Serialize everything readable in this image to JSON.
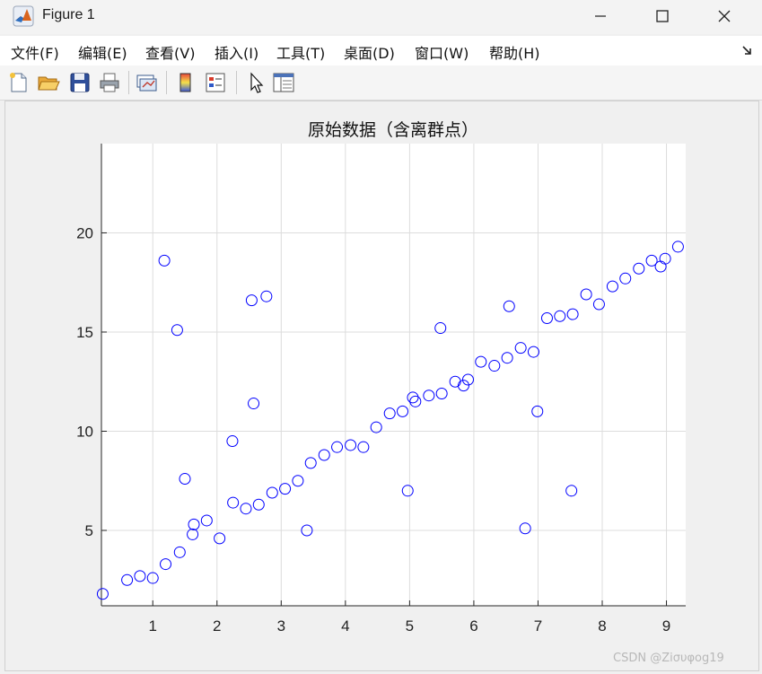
{
  "window": {
    "title": "Figure 1"
  },
  "menu": [
    {
      "label": "文件(F)",
      "name": "menu-file"
    },
    {
      "label": "编辑(E)",
      "name": "menu-edit"
    },
    {
      "label": "查看(V)",
      "name": "menu-view"
    },
    {
      "label": "插入(I)",
      "name": "menu-insert"
    },
    {
      "label": "工具(T)",
      "name": "menu-tools"
    },
    {
      "label": "桌面(D)",
      "name": "menu-desktop"
    },
    {
      "label": "窗口(W)",
      "name": "menu-window"
    },
    {
      "label": "帮助(H)",
      "name": "menu-help"
    }
  ],
  "toolbar": {
    "buttons": [
      {
        "name": "new-figure-button",
        "icon": "new-file-icon"
      },
      {
        "name": "open-file-button",
        "icon": "folder-open-icon"
      },
      {
        "name": "save-button",
        "icon": "floppy-disk-icon"
      },
      {
        "name": "print-button",
        "icon": "printer-icon"
      },
      {
        "name": "link-plot-button",
        "icon": "link-plot-icon"
      },
      {
        "name": "insert-colorbar-button",
        "icon": "colorbar-icon"
      },
      {
        "name": "insert-legend-button",
        "icon": "legend-icon"
      },
      {
        "name": "edit-plot-button",
        "icon": "cursor-arrow-icon"
      },
      {
        "name": "property-inspector-button",
        "icon": "property-panel-icon"
      }
    ]
  },
  "chart_data": {
    "type": "scatter",
    "title": "原始数据（含离群点）",
    "xlabel": "",
    "ylabel": "",
    "xlim": [
      0.2,
      9.3
    ],
    "ylim": [
      1.2,
      24.5
    ],
    "xticks": [
      1,
      2,
      3,
      4,
      5,
      6,
      7,
      8,
      9
    ],
    "yticks": [
      5,
      10,
      15,
      20
    ],
    "grid": true,
    "marker": "circle",
    "marker_color": "#0000ff",
    "points": [
      [
        0.22,
        1.8
      ],
      [
        0.6,
        2.5
      ],
      [
        0.8,
        2.7
      ],
      [
        1.0,
        2.6
      ],
      [
        1.2,
        3.3
      ],
      [
        1.42,
        3.9
      ],
      [
        1.62,
        4.8
      ],
      [
        1.64,
        5.3
      ],
      [
        1.84,
        5.5
      ],
      [
        2.04,
        4.6
      ],
      [
        2.25,
        6.4
      ],
      [
        2.45,
        6.1
      ],
      [
        2.65,
        6.3
      ],
      [
        2.86,
        6.9
      ],
      [
        3.06,
        7.1
      ],
      [
        3.26,
        7.5
      ],
      [
        3.46,
        8.4
      ],
      [
        3.67,
        8.8
      ],
      [
        3.87,
        9.2
      ],
      [
        4.08,
        9.3
      ],
      [
        4.28,
        9.2
      ],
      [
        4.48,
        10.2
      ],
      [
        4.69,
        10.9
      ],
      [
        4.89,
        11.0
      ],
      [
        5.09,
        11.5
      ],
      [
        5.05,
        11.7
      ],
      [
        5.3,
        11.8
      ],
      [
        5.5,
        11.9
      ],
      [
        5.71,
        12.5
      ],
      [
        5.84,
        12.3
      ],
      [
        5.91,
        12.6
      ],
      [
        6.11,
        13.5
      ],
      [
        6.32,
        13.3
      ],
      [
        6.52,
        13.7
      ],
      [
        6.73,
        14.2
      ],
      [
        6.93,
        14.0
      ],
      [
        7.14,
        15.7
      ],
      [
        7.34,
        15.8
      ],
      [
        7.54,
        15.9
      ],
      [
        7.75,
        16.9
      ],
      [
        7.95,
        16.4
      ],
      [
        8.16,
        17.3
      ],
      [
        8.36,
        17.7
      ],
      [
        8.57,
        18.2
      ],
      [
        8.77,
        18.6
      ],
      [
        8.91,
        18.3
      ],
      [
        8.98,
        18.7
      ],
      [
        9.18,
        19.3
      ],
      [
        1.18,
        18.6
      ],
      [
        1.38,
        15.1
      ],
      [
        2.54,
        16.6
      ],
      [
        2.77,
        16.8
      ],
      [
        1.5,
        7.6
      ],
      [
        2.24,
        9.5
      ],
      [
        2.57,
        11.4
      ],
      [
        3.4,
        5.0
      ],
      [
        4.97,
        7.0
      ],
      [
        5.48,
        15.2
      ],
      [
        6.55,
        16.3
      ],
      [
        6.8,
        5.1
      ],
      [
        6.99,
        11.0
      ],
      [
        7.52,
        7.0
      ]
    ]
  },
  "watermark": "CSDN @Ziσυφog19"
}
